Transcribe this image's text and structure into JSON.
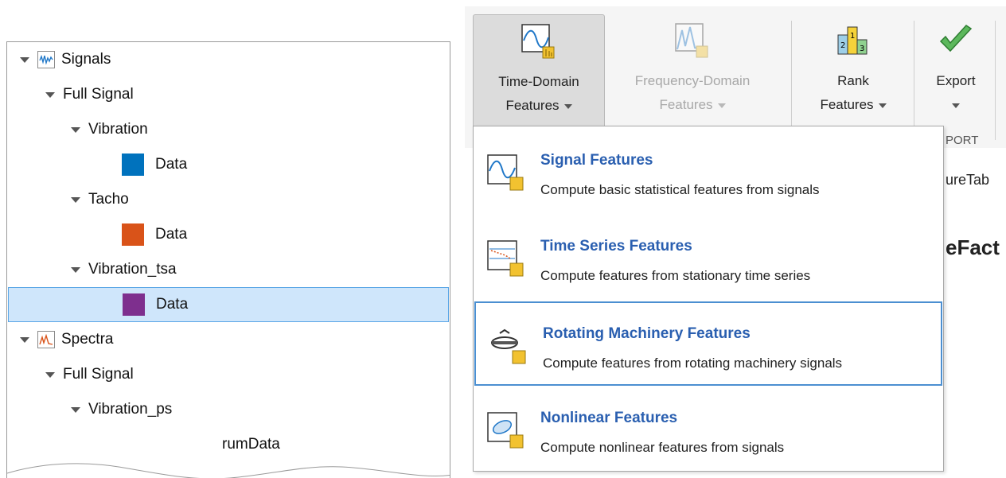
{
  "tree": {
    "items": [
      {
        "label": "Signals",
        "level": 0,
        "icon": "signal-icon"
      },
      {
        "label": "Full Signal",
        "level": 1
      },
      {
        "label": "Vibration",
        "level": 2
      },
      {
        "label": "Data",
        "level": 3,
        "color": "#0072BD"
      },
      {
        "label": "Tacho",
        "level": 2
      },
      {
        "label": "Data",
        "level": 3,
        "color": "#D95319"
      },
      {
        "label": "Vibration_tsa",
        "level": 2
      },
      {
        "label": "Data",
        "level": 3,
        "color": "#7E2F8E",
        "selected": true
      },
      {
        "label": "Spectra",
        "level": 0,
        "icon": "spectrum-icon"
      },
      {
        "label": "Full Signal",
        "level": 1
      },
      {
        "label": "Vibration_ps",
        "level": 2
      },
      {
        "label": "rumData",
        "level": 3
      }
    ]
  },
  "toolstrip": {
    "time_domain": {
      "line1": "Time-Domain",
      "line2": "Features",
      "icon": "time-domain-features-icon"
    },
    "frequency_domain": {
      "line1": "Frequency-Domain",
      "line2": "Features",
      "icon": "frequency-domain-features-icon"
    },
    "rank": {
      "line1": "Rank",
      "line2": "Features",
      "icon": "rank-features-icon"
    },
    "export": {
      "line1": "Export",
      "icon": "export-checkmark-icon"
    },
    "section_label": "PORT"
  },
  "background": {
    "ure_tab": "ureTab",
    "e_fact": "eFact"
  },
  "menu": {
    "items": [
      {
        "title": "Signal Features",
        "desc": "Compute basic statistical features from signals",
        "icon": "signal-features-icon"
      },
      {
        "title": "Time Series Features",
        "desc": "Compute features from stationary time series",
        "icon": "time-series-features-icon"
      },
      {
        "title": "Rotating Machinery Features",
        "desc": "Compute features from rotating machinery signals",
        "icon": "rotating-machinery-features-icon"
      },
      {
        "title": "Nonlinear Features",
        "desc": "Compute nonlinear features from signals",
        "icon": "nonlinear-features-icon"
      }
    ]
  },
  "colors": {
    "accent_blue": "#2a5fb0",
    "selection": "#cfe6fb",
    "selection_border": "#5aa6e6"
  }
}
